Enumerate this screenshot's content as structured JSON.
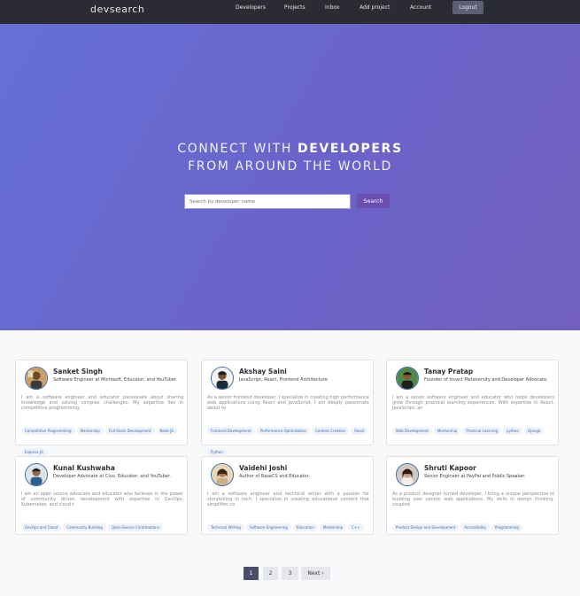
{
  "brand": "devsearch",
  "nav": {
    "links": [
      "Developers",
      "Projects",
      "Inbox",
      "Add project",
      "Account"
    ],
    "logout": "Logout"
  },
  "hero": {
    "line1_prefix": "CONNECT WITH ",
    "line1_bold": "DEVELOPERS",
    "line2": "FROM AROUND THE WORLD",
    "search_placeholder": "Search by developer name",
    "search_button": "Search"
  },
  "profiles": [
    {
      "name": "Sanket Singh",
      "title": "Software Engineer at Microsoft, Educator, and YouTuber.",
      "bio": "I am a software engineer and educator passionate about sharing knowledge and solving complex challenges. My expertise lies in competitive programming,",
      "tags": [
        "Competitive Programming",
        "Mentorship",
        "Full-Stack Development",
        "Node JS",
        "Express JS"
      ]
    },
    {
      "name": "Akshay Saini",
      "title": "JavaScript, React, Frontend Architecture",
      "bio": "As a senior frontend developer, I specialize in creating high performance web applications using React and JavaScript. I am deeply passionate about te",
      "tags": [
        "Frontend Development",
        "Performance Optimization",
        "Content Creation",
        "React",
        "Python"
      ]
    },
    {
      "name": "Tanay Pratap",
      "title": "Founder of Invact Metaversity and Developer Advocate.",
      "bio": "I am a senior software engineer and educator who helps developers grow through practical learning experiences. With expertise in React, JavaScript, an",
      "tags": [
        "Web Development",
        "Mentorship",
        "Practical Learning",
        "python",
        "Django"
      ]
    },
    {
      "name": "Kunal Kushwaha",
      "title": "Developer Advocate at Civo, Educator, and YouTuber.",
      "bio": "I am an open source advocate and educator who believes in the power of community driven development with expertise in DevOps, Kubernetes, and cloud t",
      "tags": [
        "DevOps and Cloud",
        "Community Building",
        "Open-Source Contributions"
      ]
    },
    {
      "name": "Vaidehi Joshi",
      "title": "Author of BaseCS and Educator.",
      "bio": "I am a software engineer and technical writer with a passion for storytelling in tech. I specialize in creating educational content that simplifies co",
      "tags": [
        "Technical Writing",
        "Software Engineering",
        "Education",
        "Mentorship",
        "C++"
      ]
    },
    {
      "name": "Shruti Kapoor",
      "title": "Senior Engineer at PayPal and Public Speaker.",
      "bio": "As a product designer turned developer, I bring a unique perspective to building user centric web applications. My skills in design thinking, coupled",
      "tags": [
        "Product Design and Development",
        "Accessibility",
        "Programming"
      ]
    }
  ],
  "pagination": {
    "pages": [
      "1",
      "2",
      "3"
    ],
    "next": "Next ›",
    "current": "1"
  }
}
